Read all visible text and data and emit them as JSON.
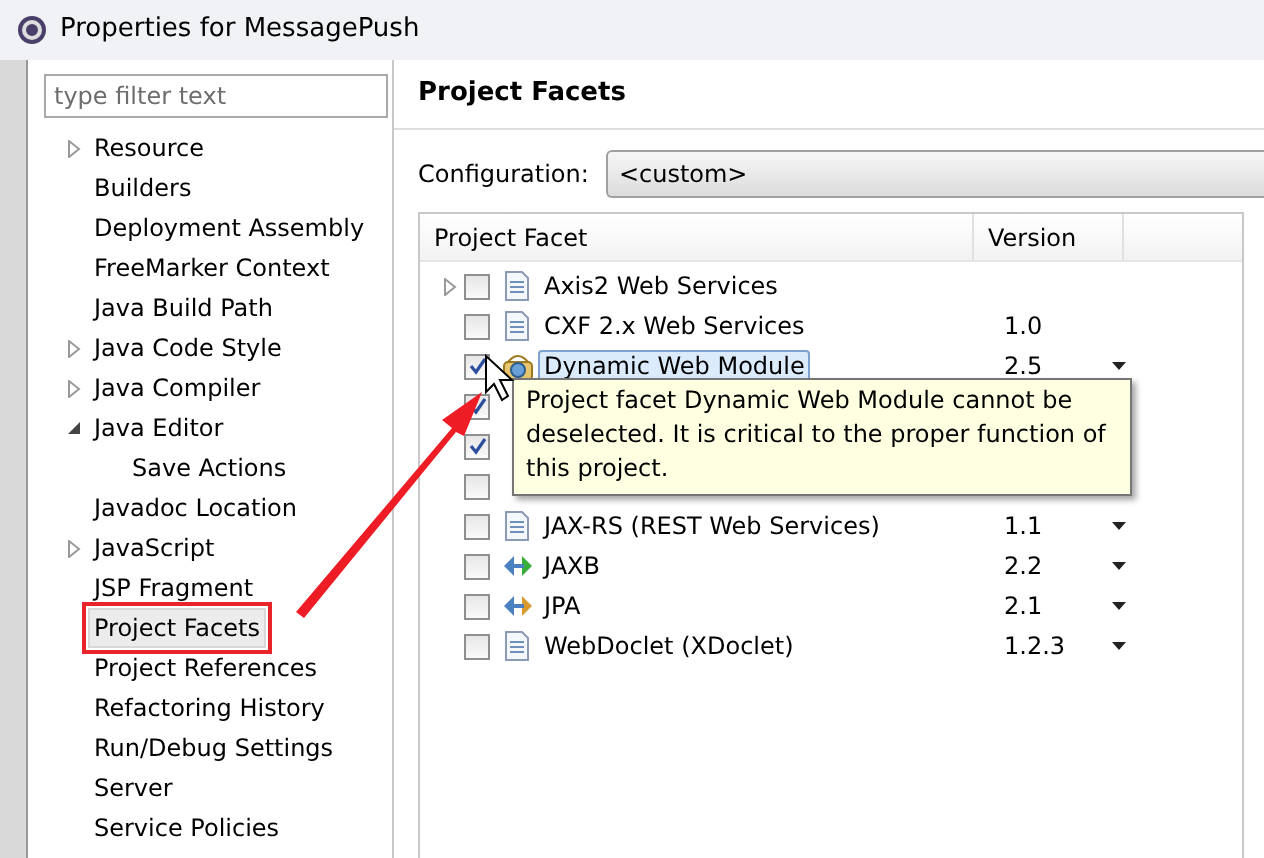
{
  "window": {
    "title": "Properties for MessagePush"
  },
  "filter": {
    "placeholder": "type filter text"
  },
  "sidebar": {
    "items": [
      {
        "label": "Resource",
        "expanded": false,
        "selected": false
      },
      {
        "label": "Builders",
        "selected": false
      },
      {
        "label": "Deployment Assembly",
        "selected": false
      },
      {
        "label": "FreeMarker Context",
        "selected": false
      },
      {
        "label": "Java Build Path",
        "selected": false
      },
      {
        "label": "Java Code Style",
        "expanded": false,
        "selected": false
      },
      {
        "label": "Java Compiler",
        "expanded": false,
        "selected": false
      },
      {
        "label": "Java Editor",
        "expanded": true,
        "selected": false,
        "children": [
          {
            "label": "Save Actions",
            "selected": false
          }
        ]
      },
      {
        "label": "Javadoc Location",
        "selected": false
      },
      {
        "label": "JavaScript",
        "expanded": false,
        "selected": false
      },
      {
        "label": "JSP Fragment",
        "selected": false
      },
      {
        "label": "Project Facets",
        "selected": true,
        "highlighted": true
      },
      {
        "label": "Project References",
        "selected": false
      },
      {
        "label": "Refactoring History",
        "selected": false
      },
      {
        "label": "Run/Debug Settings",
        "selected": false
      },
      {
        "label": "Server",
        "selected": false
      },
      {
        "label": "Service Policies",
        "selected": false
      }
    ]
  },
  "page": {
    "title": "Project Facets",
    "configuration_label": "Configuration:",
    "configuration_value": "<custom>"
  },
  "table": {
    "columns": [
      "Project Facet",
      "Version"
    ],
    "rows": [
      {
        "name": "Axis2 Web Services",
        "checked": false,
        "expanded": false,
        "kind": "document",
        "selected": false
      },
      {
        "name": "CXF 2.x Web Services",
        "version": "1.0",
        "checked": false,
        "kind": "document",
        "selected": false
      },
      {
        "name": "Dynamic Web Module",
        "version": "2.5",
        "checked": true,
        "kind": "module",
        "selected": true,
        "dropdown": true
      },
      {
        "checked": true
      },
      {
        "checked": true
      },
      {
        "checked": false
      },
      {
        "name": "JAX-RS (REST Web Services)",
        "version": "1.1",
        "checked": false,
        "kind": "document",
        "selected": false,
        "dropdown": true
      },
      {
        "name": "JAXB",
        "version": "2.2",
        "checked": false,
        "kind": "binding",
        "selected": false,
        "dropdown": true
      },
      {
        "name": "JPA",
        "version": "2.1",
        "checked": false,
        "kind": "persistence",
        "selected": false,
        "dropdown": true
      },
      {
        "name": "WebDoclet (XDoclet)",
        "version": "1.2.3",
        "checked": false,
        "kind": "document",
        "selected": false,
        "dropdown": true
      }
    ]
  },
  "tooltip": {
    "text": "Project facet Dynamic Web Module cannot be deselected. It is critical to the proper function of this project."
  }
}
